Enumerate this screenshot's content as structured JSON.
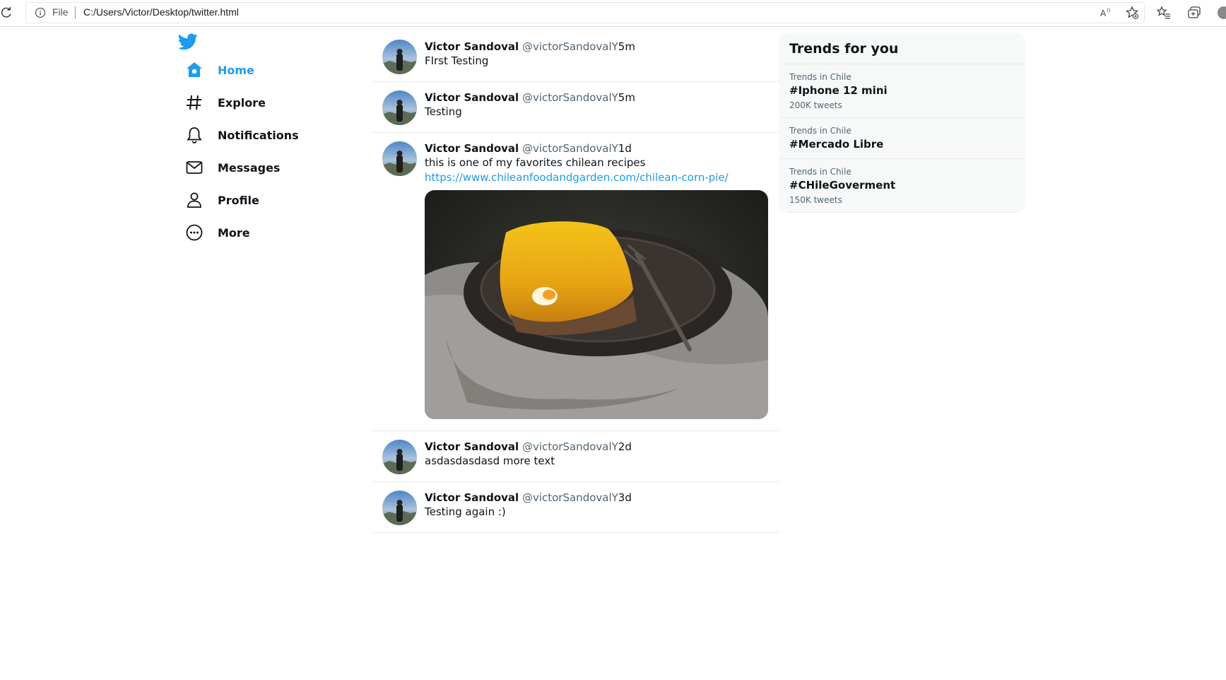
{
  "browser": {
    "file_label": "File",
    "url": "C:/Users/Victor/Desktop/twitter.html"
  },
  "nav": {
    "items": [
      {
        "label": "Home",
        "icon": "home-icon",
        "active": true
      },
      {
        "label": "Explore",
        "icon": "hashtag-icon"
      },
      {
        "label": "Notifications",
        "icon": "bell-icon"
      },
      {
        "label": "Messages",
        "icon": "envelope-icon"
      },
      {
        "label": "Profile",
        "icon": "person-icon"
      },
      {
        "label": "More",
        "icon": "more-circle-icon"
      }
    ]
  },
  "tweets": [
    {
      "author": "Victor Sandoval",
      "handle": "@victorSandovalY",
      "time": "5m",
      "text": "FIrst Testing"
    },
    {
      "author": "Victor Sandoval",
      "handle": "@victorSandovalY",
      "time": "5m",
      "text": "Testing"
    },
    {
      "author": "Victor Sandoval",
      "handle": "@victorSandovalY",
      "time": "1d",
      "text": "this is one of my favorites chilean recipes",
      "link": "https://www.chileanfoodandgarden.com/chilean-corn-pie/"
    },
    {
      "author": "Victor Sandoval",
      "handle": "@victorSandovalY",
      "time": "2d",
      "text": "asdasdasdasd more text"
    },
    {
      "author": "Victor Sandoval",
      "handle": "@victorSandovalY",
      "time": "3d",
      "text": "Testing again :)"
    }
  ],
  "trends": {
    "title": "Trends for you",
    "items": [
      {
        "context": "Trends in Chile",
        "name": "#Iphone 12 mini",
        "count": "200K tweets"
      },
      {
        "context": "Trends in Chile",
        "name": "#Mercado Libre"
      },
      {
        "context": "Trends in Chile",
        "name": "#CHileGoverment",
        "count": "150K tweets"
      }
    ]
  },
  "colors": {
    "accent": "#1d9bf0",
    "text": "#0f1419",
    "muted": "#536471",
    "trends_bg": "#f7f9f9"
  }
}
